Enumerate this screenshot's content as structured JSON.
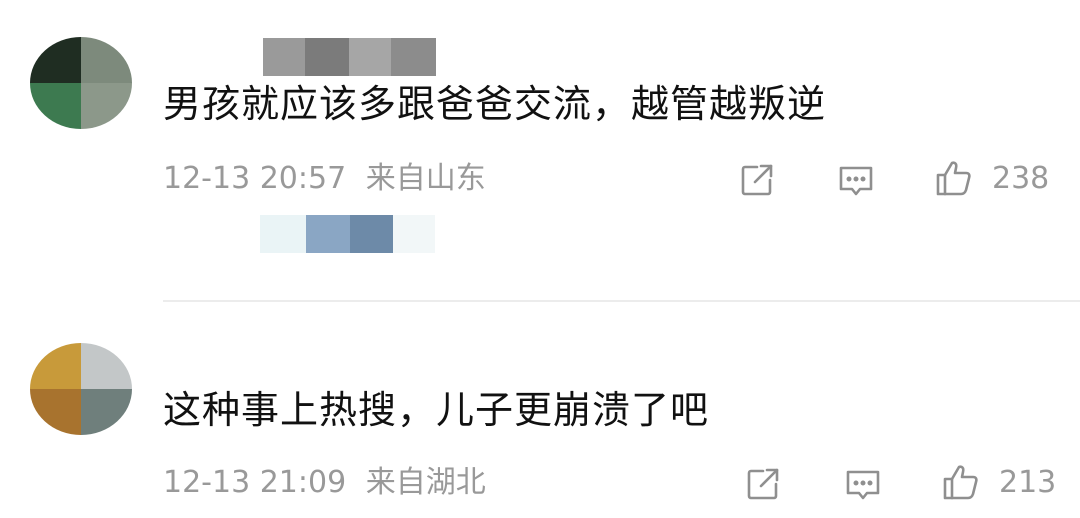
{
  "comments": [
    {
      "text": "男孩就应该多跟爸爸交流，越管越叛逆",
      "date": "12-13 20:57",
      "location": "来自山东",
      "likes": "238",
      "avatar_colors": [
        "#1f2d22",
        "#7d8a7c",
        "#3d7a50",
        "#8c988a"
      ],
      "name_blur_colors": [
        "#9a9a9a",
        "#7b7b7b",
        "#a6a6a6",
        "#8c8c8c"
      ],
      "reply_blur_colors": [
        "#eaf4f6",
        "#8aa6c4",
        "#6d8aa8",
        "#f2f7f8"
      ]
    },
    {
      "text": "这种事上热搜，儿子更崩溃了吧",
      "date": "12-13 21:09",
      "location": "来自湖北",
      "likes": "213",
      "avatar_colors": [
        "#c89a3a",
        "#c3c7c8",
        "#a8732e",
        "#6f7f7c"
      ]
    }
  ],
  "icons": {
    "share": "share-icon",
    "comment": "comment-icon",
    "like": "thumbs-up-icon"
  }
}
